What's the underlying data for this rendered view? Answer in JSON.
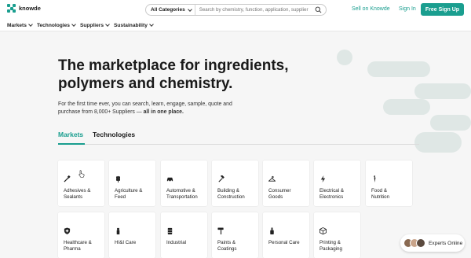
{
  "header": {
    "logo_text": "knowde",
    "search_category": "All Categories",
    "search_placeholder": "Search by chemistry, function, application, supplier",
    "sell_label": "Sell on Knowde",
    "signin_label": "Sign In",
    "signup_label": "Free Sign Up"
  },
  "menu": {
    "items": [
      {
        "label": "Markets"
      },
      {
        "label": "Technologies"
      },
      {
        "label": "Suppliers"
      },
      {
        "label": "Sustainability"
      }
    ]
  },
  "hero": {
    "title_line1": "The marketplace for ingredients,",
    "title_line2": "polymers and chemistry.",
    "sub_prefix": "For the first time ever, you can search, learn, engage, sample, quote and purchase from 8,000+ Suppliers — ",
    "sub_bold": "all in one place."
  },
  "tabs": [
    {
      "label": "Markets",
      "active": true
    },
    {
      "label": "Technologies",
      "active": false
    }
  ],
  "markets": [
    {
      "line1": "Adhesives &",
      "line2": "Sealants",
      "icon": "brush-icon"
    },
    {
      "line1": "Agriculture &",
      "line2": "Feed",
      "icon": "wheat-icon"
    },
    {
      "line1": "Automotive &",
      "line2": "Transportation",
      "icon": "car-icon"
    },
    {
      "line1": "Building &",
      "line2": "Construction",
      "icon": "hammer-icon"
    },
    {
      "line1": "Consumer",
      "line2": "Goods",
      "icon": "hanger-icon"
    },
    {
      "line1": "Electrical &",
      "line2": "Electronics",
      "icon": "bolt-icon"
    },
    {
      "line1": "Food &",
      "line2": "Nutrition",
      "icon": "carrot-icon"
    },
    {
      "line1": "Healthcare &",
      "line2": "Pharma",
      "icon": "shield-cross-icon"
    },
    {
      "line1": "HI&I Care",
      "line2": "",
      "icon": "spray-bottle-icon"
    },
    {
      "line1": "Industrial",
      "line2": "",
      "icon": "barrel-icon"
    },
    {
      "line1": "Paints &",
      "line2": "Coatings",
      "icon": "paint-roller-icon"
    },
    {
      "line1": "Personal Care",
      "line2": "",
      "icon": "lotion-bottle-icon"
    },
    {
      "line1": "Printing &",
      "line2": "Packaging",
      "icon": "box-icon"
    }
  ],
  "experts": {
    "label": "Experts Online"
  },
  "colors": {
    "accent": "#1a9e8f",
    "deco": "#dfe7e5",
    "background": "#f6f6f6"
  }
}
